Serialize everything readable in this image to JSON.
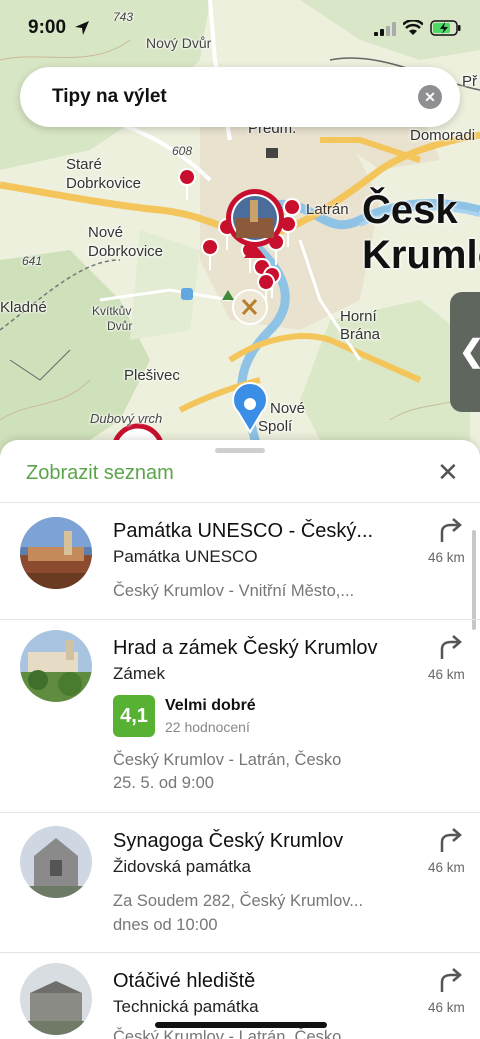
{
  "status": {
    "time": "9:00"
  },
  "search": {
    "query": "Tipy na výlet"
  },
  "map": {
    "labels": {
      "l743": "743",
      "novy_dvur": "Nový Dvůr",
      "predm": "Předm.",
      "p608": "608",
      "domoradi": "Domoradi",
      "p_edge": "Př",
      "stare": "Staré",
      "dobrkovice1": "Dobrkovice",
      "nove": "Nové",
      "dobrkovice2": "Dobrkovice",
      "l641": "641",
      "latran": "Latrán",
      "cesky": "Česk",
      "krumlov": "Krumlo",
      "kladne": "Kladné",
      "kvitkuv": "Kvítkův",
      "dvur": "Dvůr",
      "horni": "Horní",
      "brana": "Brána",
      "plesivec": "Plešivec",
      "dubovy": "Dubový vrch",
      "nove2": "Nové",
      "spoli": "Spolí"
    }
  },
  "sheet": {
    "title": "Zobrazit seznam",
    "items": [
      {
        "name": "Památka UNESCO - Český...",
        "category": "Památka UNESCO",
        "address": "Český Krumlov - Vnitřní Město,...",
        "distance": "46 km"
      },
      {
        "name": "Hrad a zámek Český Krumlov",
        "category": "Zámek",
        "rating": "4,1",
        "rating_label": "Velmi dobré",
        "rating_count": "22 hodnocení",
        "address": "Český Krumlov - Latrán, Česko",
        "hours": "25. 5. od 9:00",
        "distance": "46 km"
      },
      {
        "name": "Synagoga Český Krumlov",
        "category": "Židovská památka",
        "address": "Za Soudem 282, Český Krumlov...",
        "hours": "dnes od 10:00",
        "distance": "46 km"
      },
      {
        "name": "Otáčivé hlediště",
        "category": "Technická památka",
        "address": "Český Krumlov - Latrán, Česko",
        "distance": "46 km"
      }
    ]
  },
  "colors": {
    "accent": "#5aa54a",
    "rating": "#57b133",
    "pin": "#c8102e",
    "location": "#3a8ee6"
  }
}
